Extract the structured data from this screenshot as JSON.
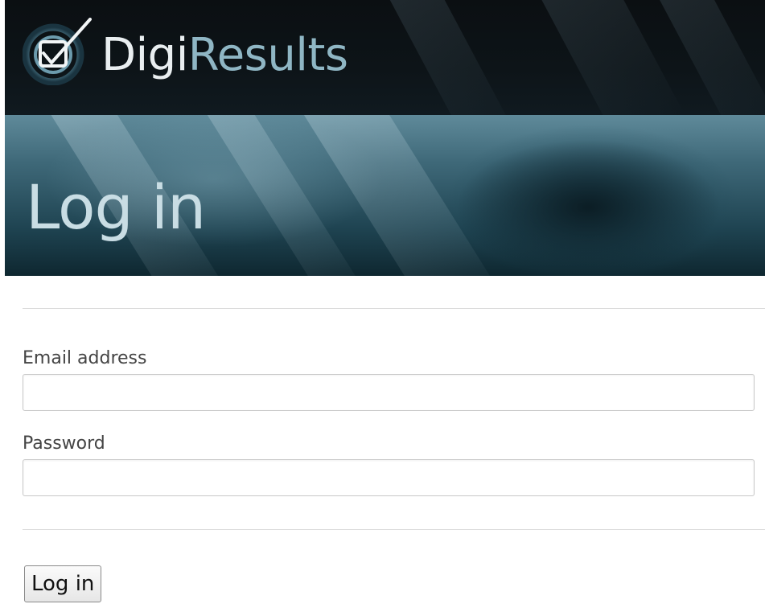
{
  "brand": {
    "name_part1": "Digi",
    "name_part2": "Results",
    "logo_icon": "check-circle-logo-icon"
  },
  "header": {
    "title": "Log in"
  },
  "form": {
    "email": {
      "label": "Email address",
      "value": "",
      "placeholder": ""
    },
    "password": {
      "label": "Password",
      "value": "",
      "placeholder": ""
    },
    "submit_label": "Log in"
  },
  "colors": {
    "brand_light": "#e9eef0",
    "brand_accent": "#8fb6c4",
    "title_color": "#c9dde4"
  }
}
